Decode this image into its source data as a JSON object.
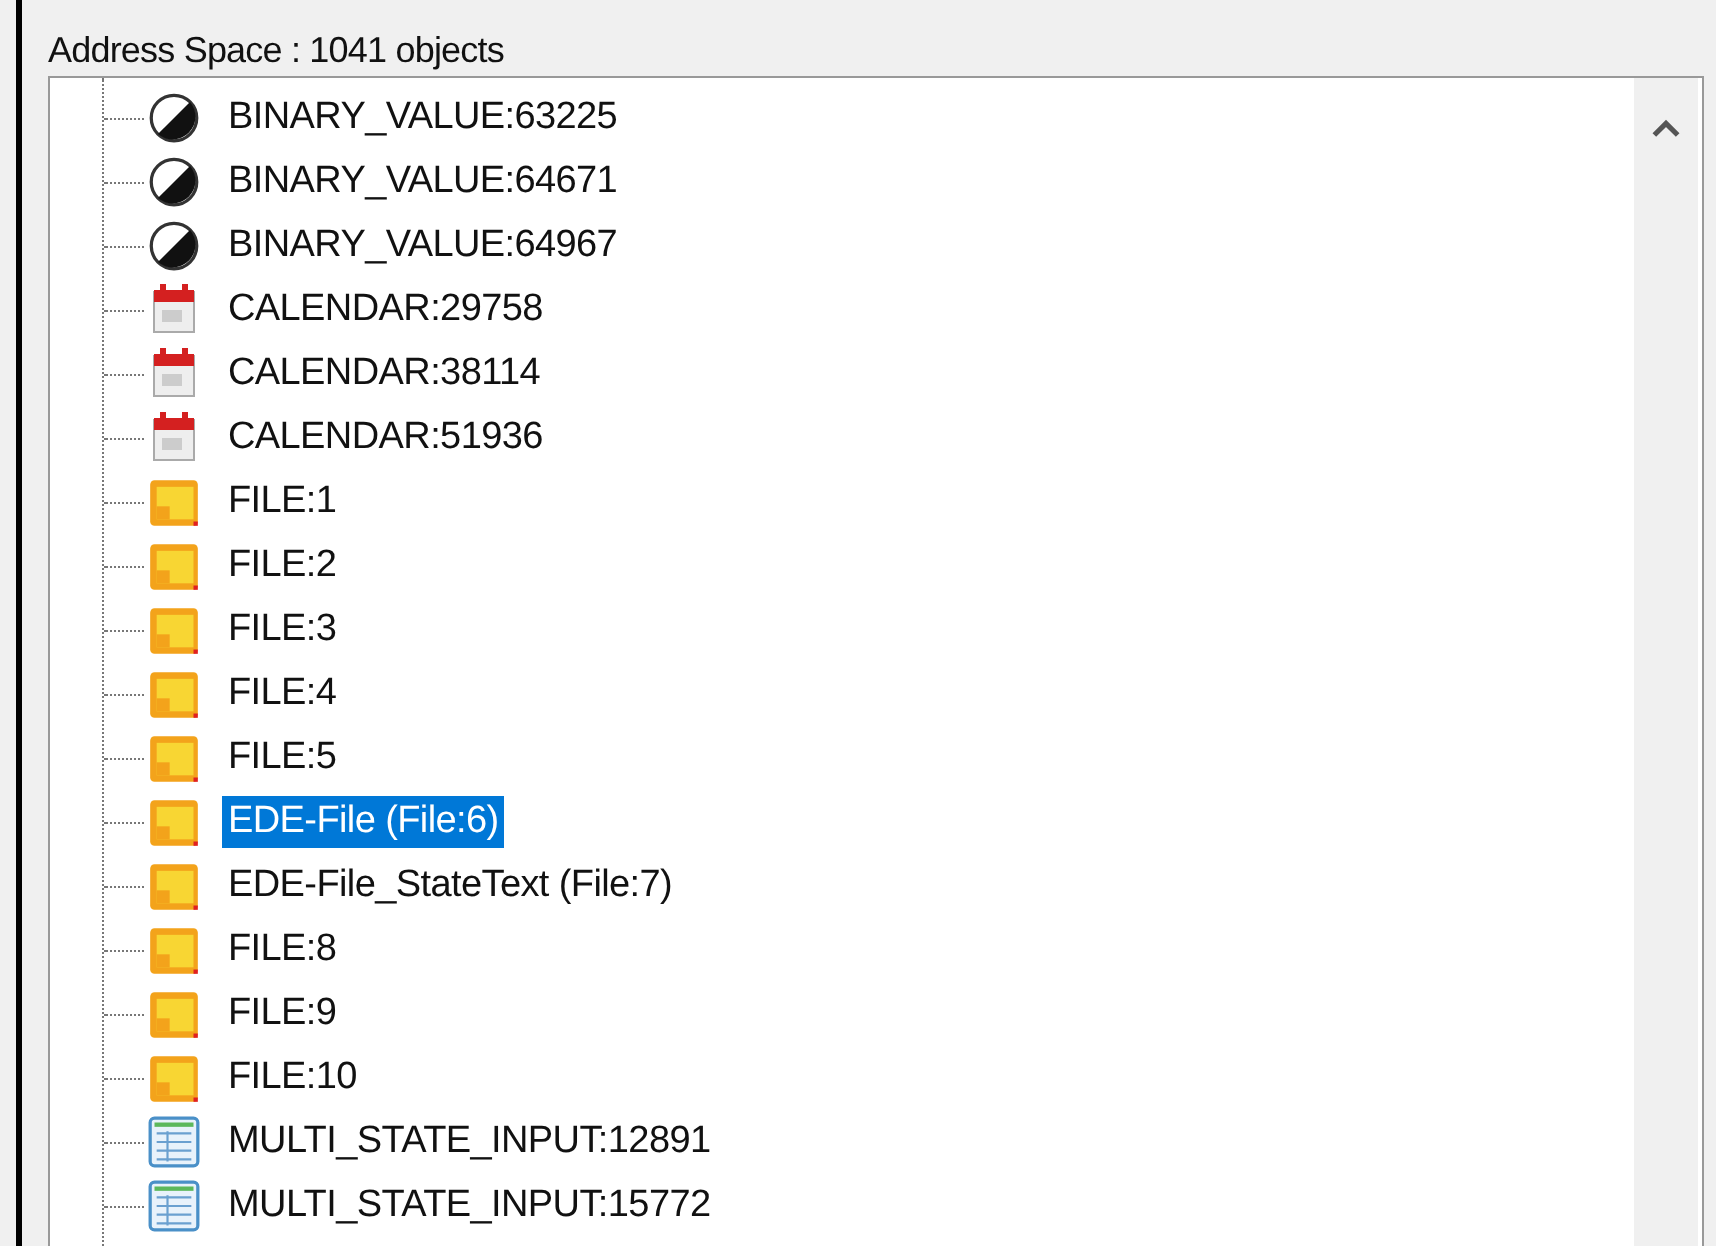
{
  "header": {
    "title": "Address Space : 1041 objects"
  },
  "tree": {
    "items": [
      {
        "kind": "binary",
        "label": "BINARY_VALUE:63225",
        "selected": false
      },
      {
        "kind": "binary",
        "label": "BINARY_VALUE:64671",
        "selected": false
      },
      {
        "kind": "binary",
        "label": "BINARY_VALUE:64967",
        "selected": false
      },
      {
        "kind": "calendar",
        "label": "CALENDAR:29758",
        "selected": false
      },
      {
        "kind": "calendar",
        "label": "CALENDAR:38114",
        "selected": false
      },
      {
        "kind": "calendar",
        "label": "CALENDAR:51936",
        "selected": false
      },
      {
        "kind": "file",
        "label": "FILE:1",
        "selected": false
      },
      {
        "kind": "file",
        "label": "FILE:2",
        "selected": false
      },
      {
        "kind": "file",
        "label": "FILE:3",
        "selected": false
      },
      {
        "kind": "file",
        "label": "FILE:4",
        "selected": false
      },
      {
        "kind": "file",
        "label": "FILE:5",
        "selected": false
      },
      {
        "kind": "file",
        "label": "EDE-File (File:6)",
        "selected": true
      },
      {
        "kind": "file",
        "label": "EDE-File_StateText (File:7)",
        "selected": false
      },
      {
        "kind": "file",
        "label": "FILE:8",
        "selected": false
      },
      {
        "kind": "file",
        "label": "FILE:9",
        "selected": false
      },
      {
        "kind": "file",
        "label": "FILE:10",
        "selected": false
      },
      {
        "kind": "multistate",
        "label": "MULTI_STATE_INPUT:12891",
        "selected": false
      },
      {
        "kind": "multistate",
        "label": "MULTI_STATE_INPUT:15772",
        "selected": false
      }
    ]
  }
}
